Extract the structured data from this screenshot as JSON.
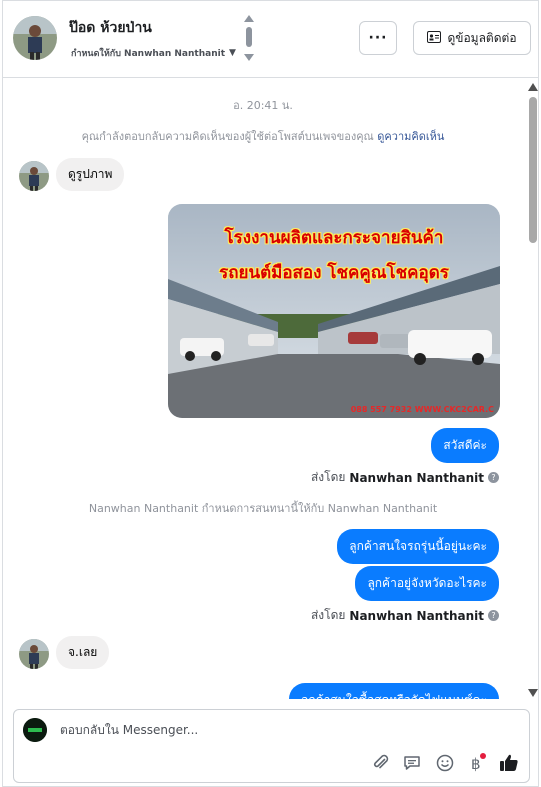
{
  "header": {
    "name": "ป๊อด ห้วยป่าน",
    "assigned_to": "กำหนดให้กับ Nanwhan Nanthanit",
    "more_label": "···",
    "contact_label": "ดูข้อมูลติดต่อ"
  },
  "messages": {
    "timestamp": "อ. 20:41 น.",
    "notice_text": "คุณกำลังตอบกลับความคิดเห็นของผู้ใช้ต่อโพสต์บนเพจของคุณ ",
    "notice_link": "ดูความคิดเห็น",
    "incoming_1": "ดูรูปภาพ",
    "photo_line_1": "โรงงานผลิตและกระจายสินค้า",
    "photo_line_2": "รถยนต์มือสอง โชคคูณโชคอุดร",
    "photo_caption": "088 557 7932 WWW.CKC2CAR.C",
    "outgoing_1": "สวัสดีค่ะ",
    "sent_by_prefix": "ส่งโดย",
    "sent_by_name": "Nanwhan Nanthanit",
    "system_assign": "Nanwhan Nanthanit กำหนดการสนทนานี้ให้กับ Nanwhan Nanthanit",
    "outgoing_2": "ลูกค้าสนใจรถรุ่นนี้อยู่นะคะ",
    "outgoing_3": "ลูกค้าอยู่จังหวัดอะไรคะ",
    "incoming_2": "จ.เลย",
    "outgoing_4": "ลูกค้าสนใจซื้อสดหรือจัดไฟแนนซ์คะ"
  },
  "composer": {
    "placeholder": "ตอบกลับใน Messenger..."
  },
  "icons": [
    "attachment-icon",
    "saved-reply-icon",
    "emoji-icon",
    "baht-payment-icon",
    "thumbs-up-icon"
  ],
  "colors": {
    "accent": "#0a7cff",
    "incoming_bubble": "#f1f0f0",
    "link": "#385898",
    "notification_dot": "#e41e3f"
  }
}
